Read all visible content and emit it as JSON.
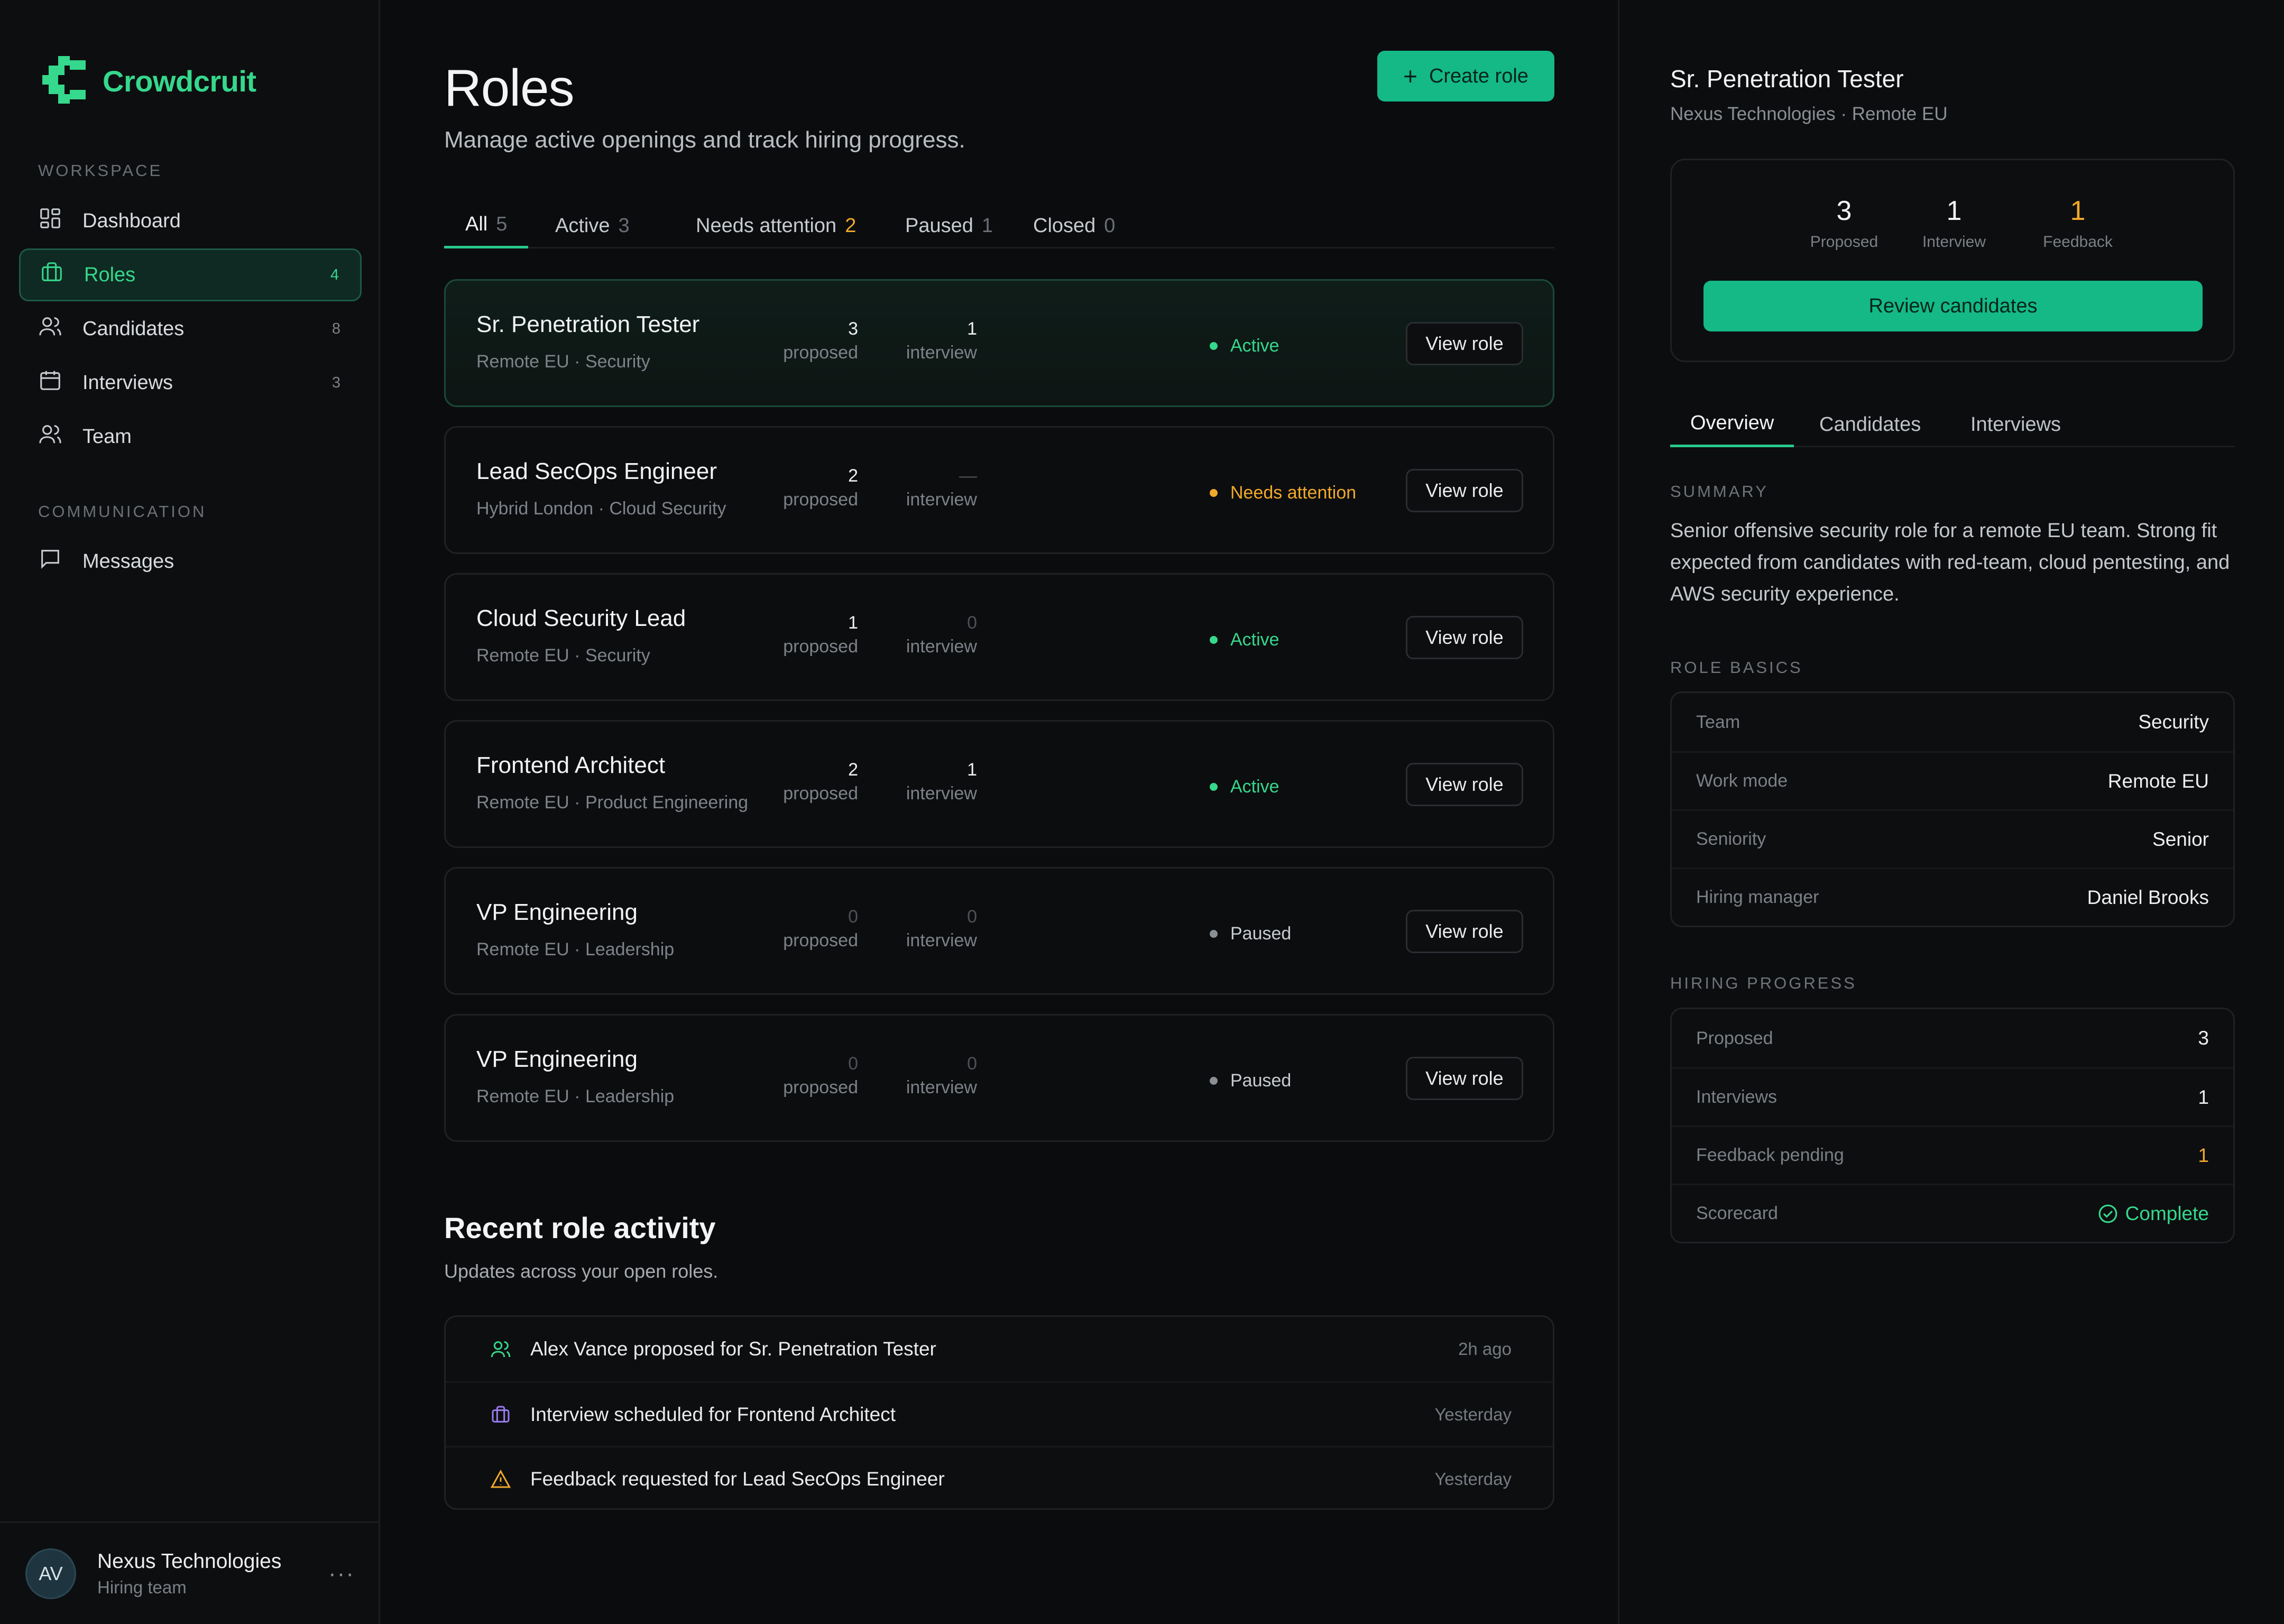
{
  "brand": {
    "name": "Crowdcruit",
    "accent": "#35d88c"
  },
  "sidebar": {
    "workspace_heading": "WORKSPACE",
    "communication_heading": "COMMUNICATION",
    "items": [
      {
        "label": "Dashboard",
        "icon": "dashboard-icon",
        "count": ""
      },
      {
        "label": "Roles",
        "icon": "briefcase-icon",
        "count": "4",
        "active": true
      },
      {
        "label": "Candidates",
        "icon": "users-icon",
        "count": "8"
      },
      {
        "label": "Interviews",
        "icon": "calendar-icon",
        "count": "3"
      },
      {
        "label": "Team",
        "icon": "team-icon",
        "count": ""
      }
    ],
    "messages": {
      "label": "Messages",
      "icon": "message-icon"
    },
    "footer": {
      "avatar": "AV",
      "org": "Nexus Technologies",
      "sub": "Hiring team",
      "more": "···"
    }
  },
  "main": {
    "title": "Roles",
    "subtitle": "Manage active openings and track hiring progress.",
    "create_button": "Create role",
    "tabs": [
      {
        "label": "All",
        "count": "5",
        "active": true
      },
      {
        "label": "Active",
        "count": "3"
      },
      {
        "label": "Needs attention",
        "count": "2",
        "warn": true
      },
      {
        "label": "Paused",
        "count": "1"
      },
      {
        "label": "Closed",
        "count": "0"
      }
    ],
    "roles": [
      {
        "title": "Sr. Penetration Tester",
        "meta": "Remote EU · Security",
        "proposed": "3",
        "interview": "1",
        "proposed_label": "proposed",
        "interview_label": "interview",
        "status": "Active",
        "status_color": "#35d88c",
        "action": "View role"
      },
      {
        "title": "Lead SecOps Engineer",
        "meta": "Hybrid London · Cloud Security",
        "proposed": "2",
        "interview": "—",
        "proposed_label": "proposed",
        "interview_label": "interview",
        "status": "Needs attention",
        "status_color": "#f0a92a",
        "action": "View role"
      },
      {
        "title": "Cloud Security Lead",
        "meta": "Remote EU · Security",
        "proposed": "1",
        "interview": "0",
        "proposed_label": "proposed",
        "interview_label": "interview",
        "status": "Active",
        "status_color": "#35d88c",
        "action": "View role"
      },
      {
        "title": "Frontend Architect",
        "meta": "Remote EU · Product Engineering",
        "proposed": "2",
        "interview": "1",
        "proposed_label": "proposed",
        "interview_label": "interview",
        "status": "Active",
        "status_color": "#35d88c",
        "action": "View role"
      },
      {
        "title": "VP Engineering",
        "meta": "Remote EU · Leadership",
        "proposed": "0",
        "interview": "0",
        "proposed_label": "proposed",
        "interview_label": "interview",
        "status": "Paused",
        "status_color": "#8a8f95",
        "action": "View role"
      },
      {
        "title": "VP Engineering",
        "meta": "Remote EU · Leadership",
        "proposed": "0",
        "interview": "0",
        "proposed_label": "proposed",
        "interview_label": "interview",
        "status": "Paused",
        "status_color": "#8a8f95",
        "action": "View role"
      }
    ],
    "activity": {
      "title": "Recent role activity",
      "subtitle": "Updates across your open roles.",
      "items": [
        {
          "icon": "users-icon",
          "text": "Alex Vance proposed for Sr. Penetration Tester",
          "time": "2h ago"
        },
        {
          "icon": "briefcase-icon",
          "text": "Interview scheduled for Frontend Architect",
          "time": "Yesterday"
        },
        {
          "icon": "warning-icon",
          "text": "Feedback requested for Lead SecOps Engineer",
          "time": "Yesterday"
        }
      ]
    }
  },
  "panel": {
    "title": "Sr. Penetration Tester",
    "subtitle": "Nexus Technologies · Remote EU",
    "stats": [
      {
        "value": "3",
        "label": "Proposed"
      },
      {
        "value": "1",
        "label": "Interview"
      },
      {
        "value": "1",
        "label": "Feedback",
        "warn": true
      }
    ],
    "review_button": "Review candidates",
    "tabs": [
      "Overview",
      "Candidates",
      "Interviews"
    ],
    "summary_heading": "SUMMARY",
    "summary": "Senior offensive security role for a remote EU team. Strong fit expected from candidates with red-team, cloud pentesting, and AWS security experience.",
    "basics_heading": "ROLE BASICS",
    "basics": [
      {
        "key": "Team",
        "value": "Security"
      },
      {
        "key": "Work mode",
        "value": "Remote EU"
      },
      {
        "key": "Seniority",
        "value": "Senior"
      },
      {
        "key": "Hiring manager",
        "value": "Daniel Brooks"
      }
    ],
    "progress_heading": "HIRING PROGRESS",
    "progress": [
      {
        "key": "Proposed",
        "value": "3"
      },
      {
        "key": "Interviews",
        "value": "1"
      },
      {
        "key": "Feedback pending",
        "value": "1",
        "tone": "warn"
      },
      {
        "key": "Scorecard",
        "value": "Complete",
        "tone": "ok",
        "icon": "check-circle-icon"
      }
    ]
  }
}
